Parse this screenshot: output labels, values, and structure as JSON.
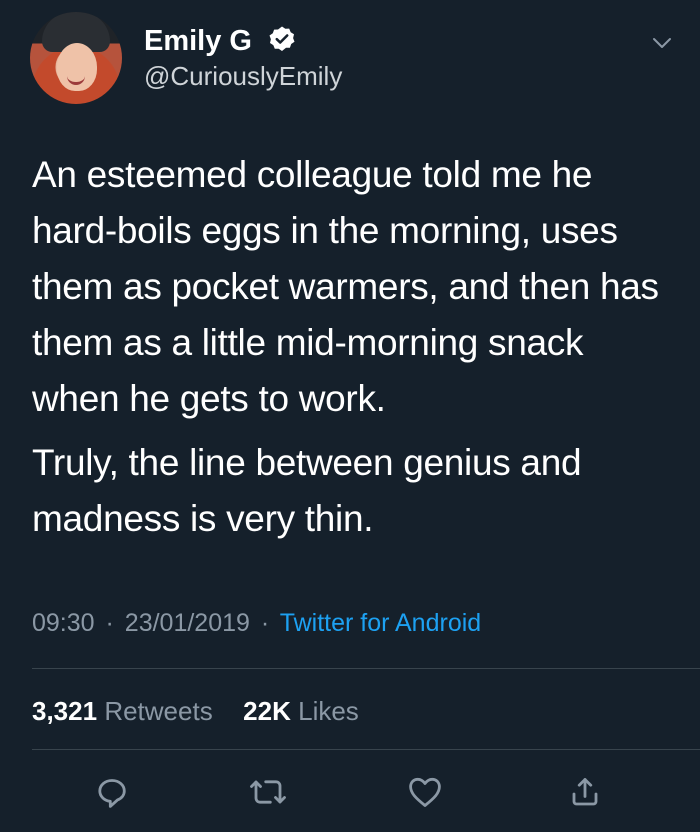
{
  "tweet": {
    "author": {
      "name": "Emily G",
      "handle": "@CuriouslyEmily",
      "verified_icon": "verified-badge-icon"
    },
    "menu_icon": "chevron-down-icon",
    "paragraphs": [
      "An esteemed colleague told me he hard-boils eggs in the morning, uses them as pocket warmers, and then has them as a little mid-morning snack when he gets to work.",
      "Truly, the line between genius and madness is very thin."
    ],
    "time": "09:30",
    "date": "23/01/2019",
    "source": "Twitter for Android",
    "separator": "·",
    "stats": {
      "retweets_value": "3,321",
      "retweets_label": "Retweets",
      "likes_value": "22K",
      "likes_label": "Likes"
    },
    "actions": [
      {
        "name": "reply",
        "icon": "reply-icon"
      },
      {
        "name": "retweet",
        "icon": "retweet-icon"
      },
      {
        "name": "like",
        "icon": "heart-icon"
      },
      {
        "name": "share",
        "icon": "share-icon"
      }
    ]
  },
  "colors": {
    "background": "#15202b",
    "text": "#ffffff",
    "secondary_text": "#8b98a5",
    "link": "#1da1f2",
    "divider": "#38444d"
  }
}
